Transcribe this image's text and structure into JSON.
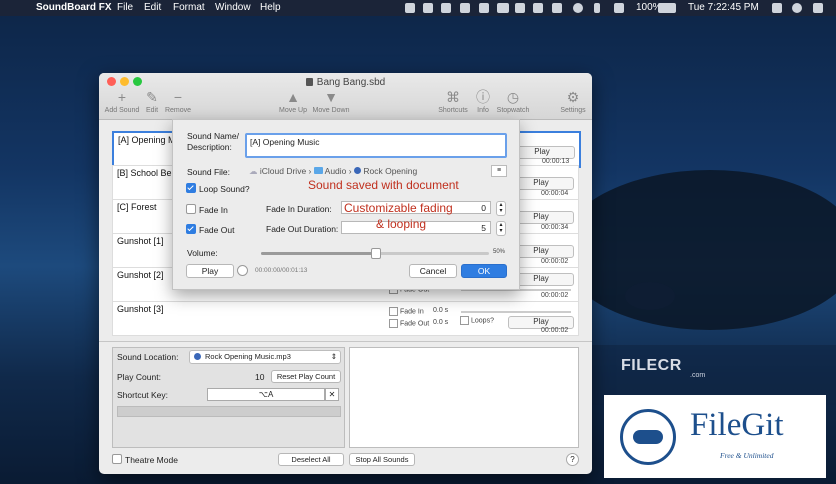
{
  "menubar": {
    "app_name": "SoundBoard FX",
    "menus": [
      "File",
      "Edit",
      "Format",
      "Window",
      "Help"
    ],
    "battery": "100%",
    "clock": "Tue 7:22:45 PM"
  },
  "window": {
    "title": "Bang Bang.sbd",
    "toolbar": {
      "add_sound": "Add Sound",
      "edit": "Edit",
      "remove": "Remove",
      "move_up": "Move Up",
      "move_down": "Move Down",
      "shortcuts": "Shortcuts",
      "info": "Info",
      "stopwatch": "Stopwatch",
      "settings": "Settings"
    },
    "sounds": [
      {
        "name": "[A] Opening Music",
        "time": "00:00:13"
      },
      {
        "name": "[B] School Bell",
        "time": "00:00:04"
      },
      {
        "name": "[C] Forest",
        "time": "00:00:34"
      },
      {
        "name": "Gunshot [1]",
        "time": "00:00:02"
      },
      {
        "name": "Gunshot [2]",
        "time": "00:00:02",
        "fade_out": "Fade Out",
        "fade_out_val": "0.0 s"
      },
      {
        "name": "Gunshot [3]",
        "time": "00:00:02",
        "fade_in": "Fade In",
        "fade_in_val": "0.0 s",
        "fade_out": "Fade Out",
        "fade_out_val": "0.0 s",
        "loops": "Loops?"
      }
    ],
    "play_label": "Play",
    "bottom": {
      "sound_location_label": "Sound Location:",
      "sound_location_value": "Rock Opening Music.mp3",
      "play_count_label": "Play Count:",
      "play_count_value": "10",
      "reset_play_count": "Reset Play Count",
      "shortcut_key_label": "Shortcut Key:",
      "shortcut_key_value": "⌥A",
      "clear_glyph": "✕"
    },
    "footer": {
      "theatre_mode": "Theatre Mode",
      "deselect_all": "Deselect All",
      "stop_all_sounds": "Stop All Sounds",
      "help": "?"
    }
  },
  "dialog": {
    "name_label": "Sound Name/\nDescription:",
    "name_value": "[A] Opening Music",
    "file_label": "Sound File:",
    "path": [
      "iCloud Drive",
      "Audio",
      "Rock Opening"
    ],
    "loop_label": "Loop Sound?",
    "fade_in_label": "Fade In",
    "fade_in_duration_label": "Fade In Duration:",
    "fade_in_value": "0",
    "fade_out_label": "Fade Out",
    "fade_out_duration_label": "Fade Out Duration:",
    "fade_out_value": "5",
    "volume_label": "Volume:",
    "volume_percent": "50%",
    "volume_level": 0.5,
    "play": "Play",
    "time_readout": "00:00:00/00:01:13",
    "cancel": "Cancel",
    "ok": "OK",
    "annotation_1": "Sound saved with document",
    "annotation_2": "Customizable fading",
    "annotation_3": "& looping"
  },
  "watermarks": {
    "filecr": "FILECR",
    "filecr_sub": ".com",
    "filegit": "FileGit",
    "filegit_sub": "Free & Unlimited"
  },
  "colors": {
    "accent": "#2f7de1",
    "annotation": "#c0301e",
    "filegit": "#1d4f8c"
  }
}
